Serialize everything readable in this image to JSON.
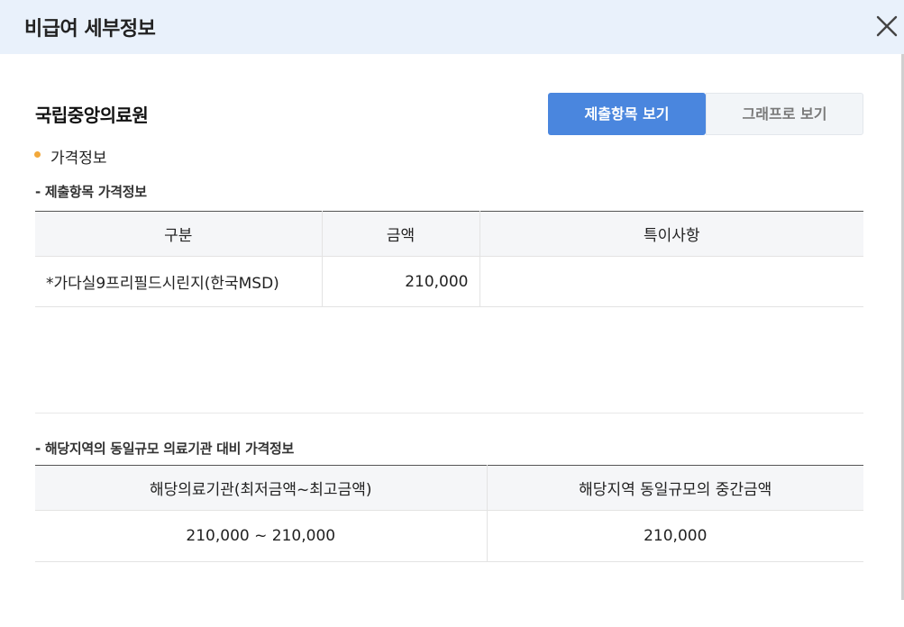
{
  "header": {
    "title": "비급여 세부정보",
    "close_icon": "close-icon"
  },
  "hospital_name": "국립중앙의료원",
  "view_toggle": {
    "submitted_label": "제출항목 보기",
    "graph_label": "그래프로 보기",
    "active": "submitted"
  },
  "section": {
    "title": "가격정보"
  },
  "submitted_table": {
    "subtitle": "- 제출항목 가격정보",
    "columns": [
      "구분",
      "금액",
      "특이사항"
    ],
    "rows": [
      {
        "name": "*가다실9프리필드시린지(한국MSD)",
        "amount": "210,000",
        "note": ""
      }
    ]
  },
  "regional_table": {
    "subtitle": "- 해당지역의 동일규모 의료기관 대비 가격정보",
    "columns": [
      "해당의료기관(최저금액~최고금액)",
      "해당지역 동일규모의 중간금액"
    ],
    "rows": [
      {
        "range": "210,000 ~ 210,000",
        "median": "210,000"
      }
    ]
  },
  "colors": {
    "header_bg": "#e9f1fb",
    "accent": "#4a86de",
    "bullet": "#f2a83b"
  }
}
